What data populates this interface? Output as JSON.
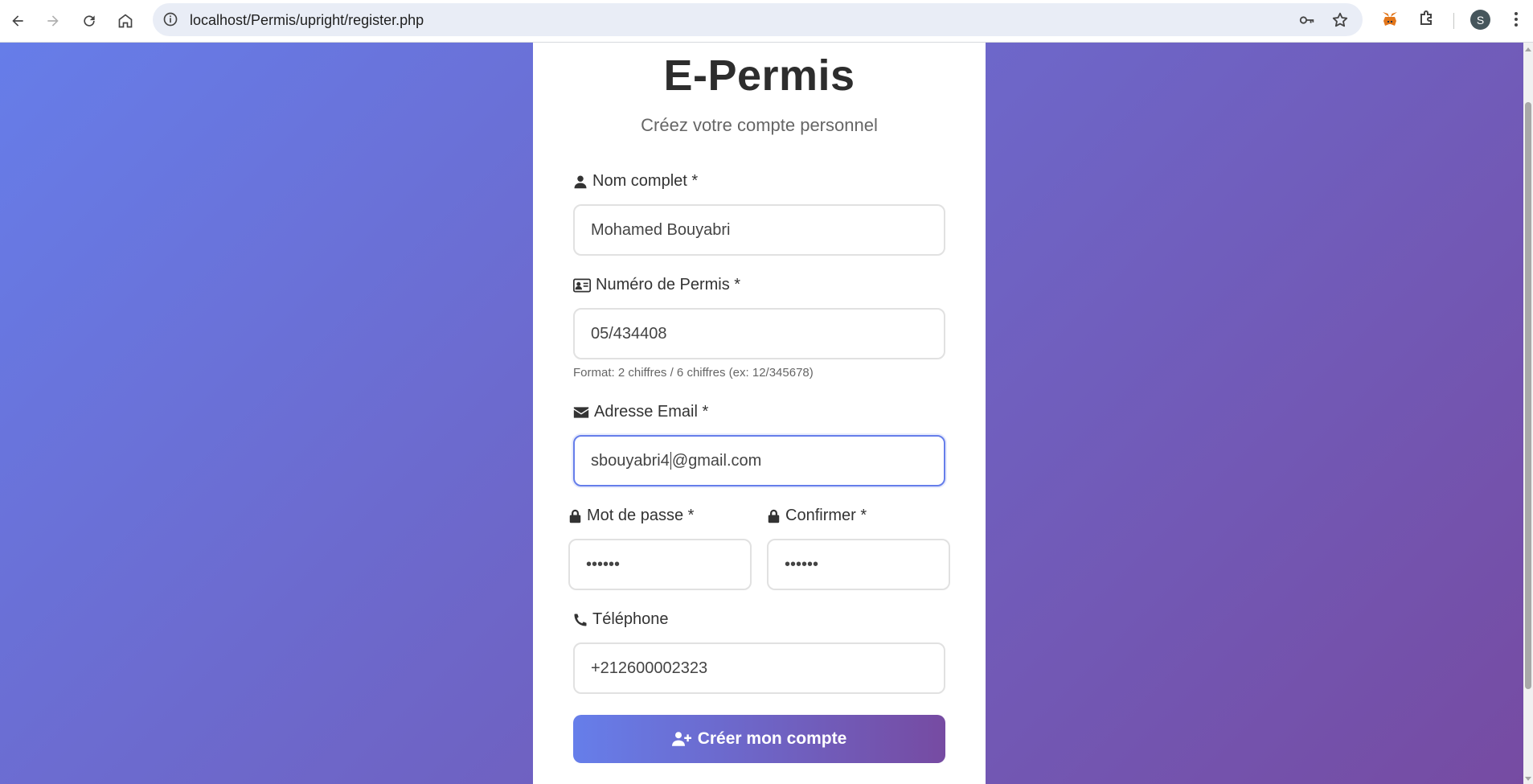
{
  "browser": {
    "url": "localhost/Permis/upright/register.php",
    "profile_initial": "S"
  },
  "page": {
    "title": "E-Permis",
    "subtitle": "Créez votre compte personnel"
  },
  "form": {
    "name": {
      "label": "Nom complet *",
      "value": "Mohamed Bouyabri"
    },
    "permis": {
      "label": "Numéro de Permis *",
      "value": "05/434408",
      "hint": "Format: 2 chiffres / 6 chiffres (ex: 12/345678)"
    },
    "email": {
      "label": "Adresse Email *",
      "value_before_caret": "sbouyabri4",
      "value_after_caret": "@gmail.com"
    },
    "password": {
      "label": "Mot de passe *",
      "value": "••••••"
    },
    "confirm": {
      "label": "Confirmer *",
      "value": "••••••"
    },
    "phone": {
      "label": "Téléphone",
      "value": "+212600002323"
    },
    "submit_label": "Créer mon compte"
  },
  "icons": {
    "name": "user-icon",
    "permis": "id-card-icon",
    "email": "envelope-icon",
    "password": "lock-icon",
    "confirm": "lock-icon",
    "phone": "phone-icon",
    "submit": "user-plus-icon"
  },
  "colors": {
    "gradient_start": "#667eea",
    "gradient_end": "#764ba2",
    "focus_border": "#667eea"
  }
}
